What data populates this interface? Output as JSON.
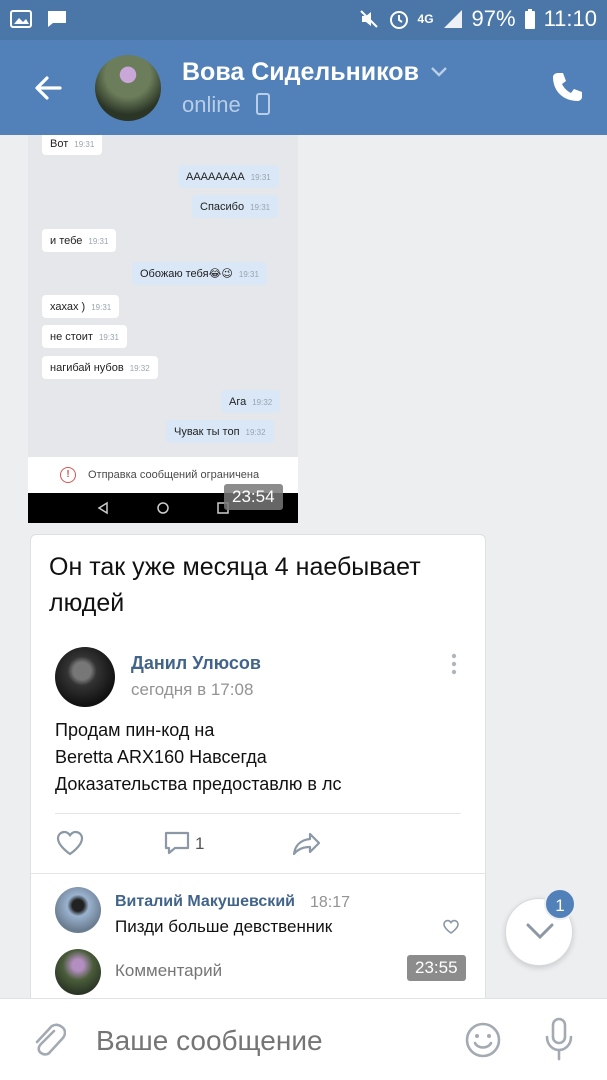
{
  "status_bar": {
    "battery": "97%",
    "time": "11:10",
    "network": "4G"
  },
  "header": {
    "name": "Вова Сидельников",
    "status": "online"
  },
  "inner_screenshot": {
    "messages": [
      {
        "text": "Вот",
        "time": "19:31",
        "dir": "in"
      },
      {
        "text": "АААААААА",
        "time": "19:31",
        "dir": "out"
      },
      {
        "text": "Спасибо",
        "time": "19:31",
        "dir": "out"
      },
      {
        "text": "и тебе",
        "time": "19:31",
        "dir": "in"
      },
      {
        "text": "Обожаю тебя😂😉",
        "time": "19:31",
        "dir": "out"
      },
      {
        "text": "хахах )",
        "time": "19:31",
        "dir": "in"
      },
      {
        "text": "не стоит",
        "time": "19:31",
        "dir": "in"
      },
      {
        "text": "нагибай нубов",
        "time": "19:32",
        "dir": "in"
      },
      {
        "text": "Ага",
        "time": "19:32",
        "dir": "out"
      },
      {
        "text": "Чувак ты топ",
        "time": "19:32",
        "dir": "out"
      }
    ],
    "restriction_notice": "Отправка сообщений ограничена",
    "timestamp_overlay": "23:54"
  },
  "post": {
    "caption": "Он так уже месяца 4 наебывает людей",
    "author": "Данил Улюсов",
    "posted_at": "сегодня в 17:08",
    "text_lines": [
      "Продам пин-код на",
      "Beretta ARX160 Навсегда",
      "Доказательства предоставлю в лс"
    ],
    "comment_count": "1",
    "comment": {
      "author": "Виталий Макушевский",
      "time": "18:17",
      "text": "Пизди больше девственник"
    },
    "comment_placeholder": "Комментарий",
    "timestamp_overlay": "23:55"
  },
  "scroll_badge": "1",
  "composer": {
    "placeholder": "Ваше сообщение"
  },
  "colors": {
    "header": "#5181b8",
    "statusbar": "#4a76a8",
    "link": "#42648b",
    "bubble_out": "#d9e7f6"
  }
}
